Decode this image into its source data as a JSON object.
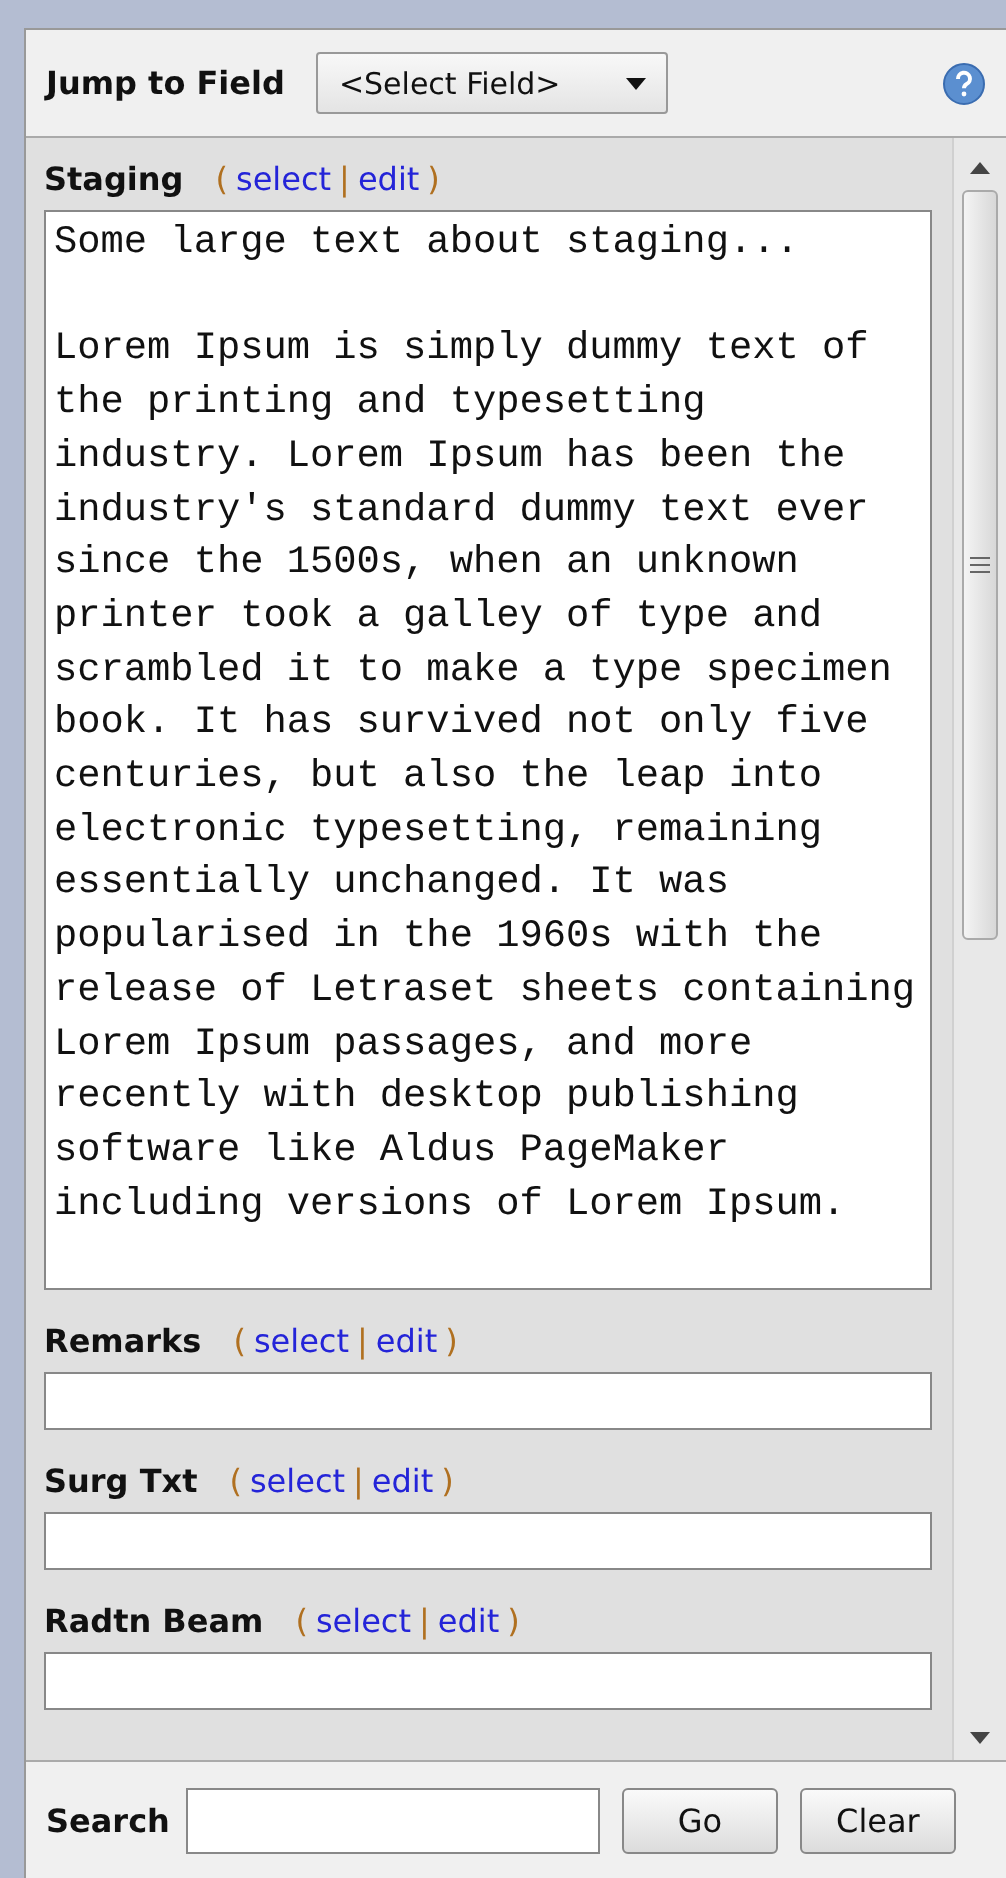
{
  "header": {
    "label": "Jump to Field",
    "dropdown": "<Select Field>"
  },
  "fields": [
    {
      "label": "Staging",
      "kind": "textarea",
      "actions": {
        "open": "(",
        "links": [
          "select",
          "edit"
        ],
        "separator": "|",
        "close": ")"
      },
      "value": "Some large text about staging...\n\nLorem Ipsum is simply dummy text of the printing and typesetting industry. Lorem Ipsum has been the industry's standard dummy text ever since the 1500s, when an unknown printer took a galley of type and scrambled it to make a type specimen book. It has survived not only five centuries, but also the leap into electronic typesetting, remaining essentially unchanged. It was popularised in the 1960s with the release of Letraset sheets containing Lorem Ipsum passages, and more recently with desktop publishing software like Aldus PageMaker including versions of Lorem Ipsum."
    },
    {
      "label": "Remarks",
      "kind": "input",
      "actions": {
        "open": "(",
        "links": [
          "select",
          "edit"
        ],
        "separator": "|",
        "close": ")"
      }
    },
    {
      "label": "Surg Txt",
      "kind": "input",
      "actions": {
        "open": "(",
        "links": [
          "select",
          "edit"
        ],
        "separator": "|",
        "close": ")"
      }
    },
    {
      "label": "Radtn Beam",
      "kind": "input",
      "actions": {
        "open": "(",
        "links": [
          "select",
          "edit"
        ],
        "separator": "|",
        "close": ")"
      }
    }
  ],
  "search": {
    "label": "Search",
    "buttons": [
      "Go",
      "Clear"
    ]
  }
}
